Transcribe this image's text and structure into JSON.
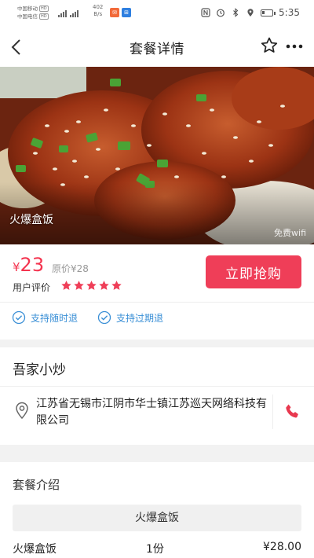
{
  "status_bar": {
    "carrier1": "中国移动",
    "carrier2": "中国电信",
    "hd": "HD",
    "network_speed": "402",
    "speed_unit": "B/s",
    "time": "5:35",
    "battery_level": 0.25
  },
  "nav": {
    "title": "套餐详情",
    "back_icon": "chevron-left-icon",
    "favorite_icon": "star-outline-icon",
    "more_icon": "more-dots-icon"
  },
  "hero": {
    "dish_name": "火爆盒饭",
    "wifi_text": "免费wifi"
  },
  "price": {
    "yen": "¥",
    "current": "23",
    "original": "原价¥28",
    "rating_label": "用户评价",
    "rating": 5,
    "buy_button": "立即抢购",
    "accent_color": "#ef3e58"
  },
  "guarantees": [
    {
      "label": "支持随时退"
    },
    {
      "label": "支持过期退"
    }
  ],
  "merchant": {
    "name": "吾家小炒",
    "address": "江苏省无锡市江阴市华士镇江苏巡天网络科技有限公司"
  },
  "package_intro": {
    "title": "套餐介绍",
    "group_name": "火爆盒饭",
    "items": [
      {
        "name": "火爆盒饭",
        "qty": "1份",
        "price": "¥28.00"
      }
    ]
  }
}
